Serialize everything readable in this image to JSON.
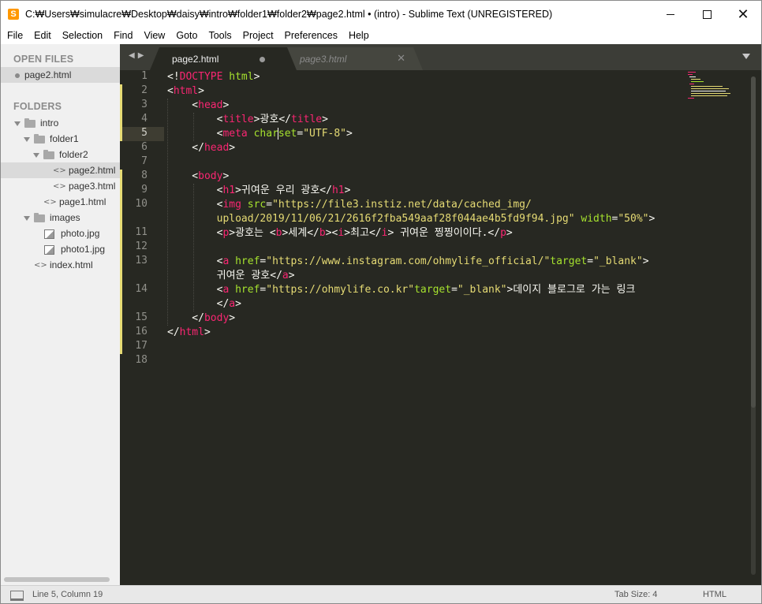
{
  "window": {
    "title": "C:₩Users₩simulacre₩Desktop₩daisy₩intro₩folder1₩folder2₩page2.html • (intro) - Sublime Text (UNREGISTERED)",
    "app_icon": "S"
  },
  "menu": [
    "File",
    "Edit",
    "Selection",
    "Find",
    "View",
    "Goto",
    "Tools",
    "Project",
    "Preferences",
    "Help"
  ],
  "sidebar": {
    "open_files_heading": "OPEN FILES",
    "open_files": [
      {
        "label": "page2.html"
      }
    ],
    "folders_heading": "FOLDERS",
    "tree": [
      {
        "label": "intro",
        "type": "folder",
        "depth": 0
      },
      {
        "label": "folder1",
        "type": "folder",
        "depth": 1
      },
      {
        "label": "folder2",
        "type": "folder",
        "depth": 2
      },
      {
        "label": "page2.html",
        "type": "code",
        "depth": 3,
        "selected": true
      },
      {
        "label": "page3.html",
        "type": "code",
        "depth": 3
      },
      {
        "label": "page1.html",
        "type": "code",
        "depth": 2
      },
      {
        "label": "images",
        "type": "folder",
        "depth": 1
      },
      {
        "label": "photo.jpg",
        "type": "image",
        "depth": 2
      },
      {
        "label": "photo1.jpg",
        "type": "image",
        "depth": 2
      },
      {
        "label": "index.html",
        "type": "code",
        "depth": 1
      }
    ]
  },
  "tabs": [
    {
      "label": "page2.html",
      "active": true,
      "dirty": true
    },
    {
      "label": "page3.html",
      "active": false,
      "dirty": false
    }
  ],
  "editor": {
    "current_line": 5,
    "lines": [
      {
        "n": "1",
        "tokens": [
          [
            "p",
            "<!"
          ],
          [
            "t",
            "DOCTYPE"
          ],
          [
            "p",
            " "
          ],
          [
            "a",
            "html"
          ],
          [
            "p",
            ">"
          ]
        ]
      },
      {
        "n": "2",
        "tokens": [
          [
            "p",
            "<"
          ],
          [
            "t",
            "html"
          ],
          [
            "p",
            ">"
          ]
        ]
      },
      {
        "n": "3",
        "tokens": [
          [
            "p",
            "    <"
          ],
          [
            "t",
            "head"
          ],
          [
            "p",
            ">"
          ]
        ]
      },
      {
        "n": "4",
        "tokens": [
          [
            "p",
            "        <"
          ],
          [
            "t",
            "title"
          ],
          [
            "p",
            ">광호</"
          ],
          [
            "t",
            "title"
          ],
          [
            "p",
            ">"
          ]
        ]
      },
      {
        "n": "5",
        "tokens": [
          [
            "p",
            "        <"
          ],
          [
            "t",
            "meta"
          ],
          [
            "p",
            " "
          ],
          [
            "a",
            "char"
          ],
          [
            "caret",
            ""
          ],
          [
            "a",
            "set"
          ],
          [
            "p",
            "="
          ],
          [
            "s",
            "\"UTF-8\""
          ],
          [
            "p",
            ">"
          ]
        ]
      },
      {
        "n": "6",
        "tokens": [
          [
            "p",
            "    </"
          ],
          [
            "t",
            "head"
          ],
          [
            "p",
            ">"
          ]
        ]
      },
      {
        "n": "7",
        "tokens": []
      },
      {
        "n": "8",
        "tokens": [
          [
            "p",
            "    <"
          ],
          [
            "t",
            "body"
          ],
          [
            "p",
            ">"
          ]
        ]
      },
      {
        "n": "9",
        "tokens": [
          [
            "p",
            "        <"
          ],
          [
            "t",
            "h1"
          ],
          [
            "p",
            ">귀여운 우리 광호</"
          ],
          [
            "t",
            "h1"
          ],
          [
            "p",
            ">"
          ]
        ]
      },
      {
        "n": "10",
        "tokens": [
          [
            "p",
            "        <"
          ],
          [
            "t",
            "img"
          ],
          [
            "p",
            " "
          ],
          [
            "a",
            "src"
          ],
          [
            "p",
            "="
          ],
          [
            "s",
            "\"https://file3.instiz.net/data/cached_img/"
          ]
        ]
      },
      {
        "n": "",
        "tokens": [
          [
            "s",
            "        upload/2019/11/06/21/2616f2fba549aaf28f044ae4b5fd9f94.jpg\""
          ],
          [
            "p",
            " "
          ],
          [
            "a",
            "width"
          ],
          [
            "p",
            "="
          ],
          [
            "s",
            "\"50%\""
          ],
          [
            "p",
            ">"
          ]
        ]
      },
      {
        "n": "11",
        "tokens": [
          [
            "p",
            "        <"
          ],
          [
            "t",
            "p"
          ],
          [
            "p",
            ">광호는 <"
          ],
          [
            "t",
            "b"
          ],
          [
            "p",
            ">세계</"
          ],
          [
            "t",
            "b"
          ],
          [
            "p",
            "><"
          ],
          [
            "t",
            "i"
          ],
          [
            "p",
            ">최고</"
          ],
          [
            "t",
            "i"
          ],
          [
            "p",
            "> 귀여운 찡찡이이다.</"
          ],
          [
            "t",
            "p"
          ],
          [
            "p",
            ">"
          ]
        ]
      },
      {
        "n": "12",
        "tokens": []
      },
      {
        "n": "13",
        "tokens": [
          [
            "p",
            "        <"
          ],
          [
            "t",
            "a"
          ],
          [
            "p",
            " "
          ],
          [
            "a",
            "href"
          ],
          [
            "p",
            "="
          ],
          [
            "s",
            "\"https://www.instagram.com/ohmylife_official/\""
          ],
          [
            "a",
            "target"
          ],
          [
            "p",
            "="
          ],
          [
            "s",
            "\"_blank\""
          ],
          [
            "p",
            ">"
          ]
        ]
      },
      {
        "n": "",
        "tokens": [
          [
            "p",
            "        귀여운 광호</"
          ],
          [
            "t",
            "a"
          ],
          [
            "p",
            ">"
          ]
        ]
      },
      {
        "n": "14",
        "tokens": [
          [
            "p",
            "        <"
          ],
          [
            "t",
            "a"
          ],
          [
            "p",
            " "
          ],
          [
            "a",
            "href"
          ],
          [
            "p",
            "="
          ],
          [
            "s",
            "\"https://ohmylife.co.kr\""
          ],
          [
            "a",
            "target"
          ],
          [
            "p",
            "="
          ],
          [
            "s",
            "\"_blank\""
          ],
          [
            "p",
            ">데이지 블로그로 가는 링크"
          ]
        ]
      },
      {
        "n": "",
        "tokens": [
          [
            "p",
            "        </"
          ],
          [
            "t",
            "a"
          ],
          [
            "p",
            ">"
          ]
        ]
      },
      {
        "n": "15",
        "tokens": [
          [
            "p",
            "    </"
          ],
          [
            "t",
            "body"
          ],
          [
            "p",
            ">"
          ]
        ]
      },
      {
        "n": "16",
        "tokens": [
          [
            "p",
            "</"
          ],
          [
            "t",
            "html"
          ],
          [
            "p",
            ">"
          ]
        ]
      },
      {
        "n": "17",
        "tokens": []
      },
      {
        "n": "18",
        "tokens": []
      }
    ]
  },
  "statusbar": {
    "position": "Line 5, Column 19",
    "tab_size": "Tab Size: 4",
    "syntax": "HTML"
  },
  "colors": {
    "editor_bg": "#272822",
    "tag": "#f92672",
    "attr": "#a6e22e",
    "string": "#e6db74",
    "plain": "#f8f8f2"
  }
}
